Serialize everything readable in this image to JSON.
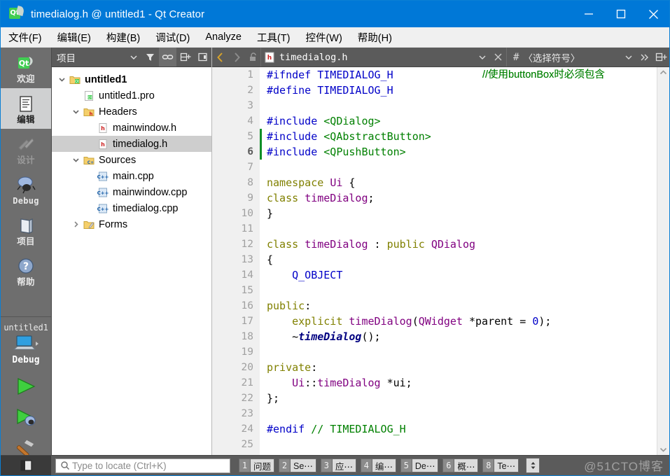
{
  "window": {
    "title": "timedialog.h @ untitled1 - Qt Creator",
    "app_icon": "qt-logo-icon",
    "minimize_label": "minimize-icon",
    "maximize_label": "maximize-icon",
    "close_label": "close-icon",
    "titlebar_color": "#0078d7"
  },
  "menubar": {
    "items": [
      {
        "text": "文件(F)",
        "mnemonic": "F"
      },
      {
        "text": "编辑(E)",
        "mnemonic": "E"
      },
      {
        "text": "构建(B)",
        "mnemonic": "B"
      },
      {
        "text": "调试(D)",
        "mnemonic": "D"
      },
      {
        "text": "Analyze",
        "mnemonic": "A"
      },
      {
        "text": "工具(T)",
        "mnemonic": "T"
      },
      {
        "text": "控件(W)",
        "mnemonic": "W"
      },
      {
        "text": "帮助(H)",
        "mnemonic": "H"
      }
    ]
  },
  "modebar": {
    "modes": [
      {
        "label": "欢迎",
        "icon": "qt-welcome-icon",
        "state": "normal"
      },
      {
        "label": "编辑",
        "icon": "document-edit-icon",
        "state": "selected"
      },
      {
        "label": "设计",
        "icon": "design-brush-icon",
        "state": "disabled"
      },
      {
        "label": "Debug",
        "icon": "bug-icon",
        "state": "normal"
      },
      {
        "label": "项目",
        "icon": "projects-book-icon",
        "state": "normal"
      },
      {
        "label": "帮助",
        "icon": "help-question-icon",
        "state": "normal"
      }
    ],
    "kit": {
      "project": "untitled1",
      "icon": "desktop-target-icon",
      "build_config": "Debug"
    },
    "actions": [
      {
        "name": "run-button",
        "icon": "green-play-icon"
      },
      {
        "name": "debug-button",
        "icon": "play-bug-icon"
      },
      {
        "name": "build-button",
        "icon": "hammer-icon"
      }
    ]
  },
  "project_panel": {
    "combo_label": "项目",
    "toolbar_icons": [
      {
        "name": "filter-icon"
      },
      {
        "name": "link-sync-icon",
        "active": true
      },
      {
        "name": "split-add-icon"
      },
      {
        "name": "close-panel-icon"
      }
    ],
    "tree": [
      {
        "label": "untitled1",
        "indent": 0,
        "arrow": "down",
        "icon": "qt-project-icon",
        "bold": true,
        "selected": false
      },
      {
        "label": "untitled1.pro",
        "indent": 1,
        "arrow": "none",
        "icon": "pro-file-icon",
        "bold": false,
        "selected": false
      },
      {
        "label": "Headers",
        "indent": 1,
        "arrow": "down",
        "icon": "folder-h-icon",
        "bold": false,
        "selected": false
      },
      {
        "label": "mainwindow.h",
        "indent": 2,
        "arrow": "none",
        "icon": "header-file-icon",
        "bold": false,
        "selected": false
      },
      {
        "label": "timedialog.h",
        "indent": 2,
        "arrow": "none",
        "icon": "header-file-icon",
        "bold": false,
        "selected": true
      },
      {
        "label": "Sources",
        "indent": 1,
        "arrow": "down",
        "icon": "folder-cpp-icon",
        "bold": false,
        "selected": false
      },
      {
        "label": "main.cpp",
        "indent": 2,
        "arrow": "none",
        "icon": "cpp-file-icon",
        "bold": false,
        "selected": false
      },
      {
        "label": "mainwindow.cpp",
        "indent": 2,
        "arrow": "none",
        "icon": "cpp-file-icon",
        "bold": false,
        "selected": false
      },
      {
        "label": "timedialog.cpp",
        "indent": 2,
        "arrow": "none",
        "icon": "cpp-file-icon",
        "bold": false,
        "selected": false
      },
      {
        "label": "Forms",
        "indent": 1,
        "arrow": "right",
        "icon": "folder-forms-icon",
        "bold": false,
        "selected": false
      }
    ]
  },
  "editor_toolbar": {
    "back_icon": "back-arrow-icon",
    "forward_icon": "forward-arrow-icon",
    "lock_icon": "unlocked-padlock-icon",
    "file_icon": "header-file-icon",
    "file_name": "timedialog.h",
    "file_dropdown_icon": "chevron-down-icon",
    "close_icon": "close-icon",
    "symbol_hash": "#",
    "symbol_label": "〈选择符号〉",
    "symbol_dropdown_icon": "chevron-down-icon",
    "overflow_icon": "chevron-double-right-icon",
    "split_icon": "split-editor-icon"
  },
  "editor": {
    "current_line": 6,
    "lines": [
      {
        "n": 1,
        "fold": "",
        "changed": false,
        "tokens": [
          {
            "t": "#ifndef ",
            "c": "pre"
          },
          {
            "t": "TIMEDIALOG_H",
            "c": "mac"
          }
        ]
      },
      {
        "n": 2,
        "fold": "",
        "changed": false,
        "tokens": [
          {
            "t": "#define ",
            "c": "pre"
          },
          {
            "t": "TIMEDIALOG_H",
            "c": "mac"
          }
        ]
      },
      {
        "n": 3,
        "fold": "",
        "changed": false,
        "tokens": []
      },
      {
        "n": 4,
        "fold": "",
        "changed": false,
        "tokens": [
          {
            "t": "#include ",
            "c": "pre"
          },
          {
            "t": "<QDialog>",
            "c": "str"
          }
        ]
      },
      {
        "n": 5,
        "fold": "",
        "changed": true,
        "tokens": [
          {
            "t": "#include ",
            "c": "pre"
          },
          {
            "t": "<QAbstractButton>",
            "c": "str"
          }
        ],
        "comment": "//使用buttonBox时必须包含"
      },
      {
        "n": 6,
        "fold": "",
        "changed": true,
        "tokens": [
          {
            "t": "#include ",
            "c": "pre"
          },
          {
            "t": "<QPushButton>",
            "c": "str"
          }
        ],
        "comment": "//使用buttonBox时必须包含"
      },
      {
        "n": 7,
        "fold": "",
        "changed": false,
        "tokens": []
      },
      {
        "n": 8,
        "fold": "down",
        "changed": false,
        "tokens": [
          {
            "t": "namespace ",
            "c": "key"
          },
          {
            "t": "Ui",
            "c": "typ"
          },
          {
            "t": " {",
            "c": "txt"
          }
        ]
      },
      {
        "n": 9,
        "fold": "",
        "changed": false,
        "tokens": [
          {
            "t": "class ",
            "c": "key"
          },
          {
            "t": "timeDialog",
            "c": "typ"
          },
          {
            "t": ";",
            "c": "txt"
          }
        ]
      },
      {
        "n": 10,
        "fold": "",
        "changed": false,
        "tokens": [
          {
            "t": "}",
            "c": "txt"
          }
        ]
      },
      {
        "n": 11,
        "fold": "",
        "changed": false,
        "tokens": []
      },
      {
        "n": 12,
        "fold": "down",
        "changed": false,
        "tokens": [
          {
            "t": "class ",
            "c": "key"
          },
          {
            "t": "timeDialog",
            "c": "typ"
          },
          {
            "t": " : ",
            "c": "txt"
          },
          {
            "t": "public ",
            "c": "key"
          },
          {
            "t": "QDialog",
            "c": "typ"
          }
        ]
      },
      {
        "n": 13,
        "fold": "",
        "changed": false,
        "tokens": [
          {
            "t": "{",
            "c": "txt"
          }
        ]
      },
      {
        "n": 14,
        "fold": "",
        "changed": false,
        "tokens": [
          {
            "t": "    Q_OBJECT",
            "c": "mac"
          }
        ]
      },
      {
        "n": 15,
        "fold": "",
        "changed": false,
        "tokens": []
      },
      {
        "n": 16,
        "fold": "",
        "changed": false,
        "tokens": [
          {
            "t": "public",
            "c": "key"
          },
          {
            "t": ":",
            "c": "txt"
          }
        ]
      },
      {
        "n": 17,
        "fold": "",
        "changed": false,
        "tokens": [
          {
            "t": "    ",
            "c": "txt"
          },
          {
            "t": "explicit ",
            "c": "key"
          },
          {
            "t": "timeDialog",
            "c": "typ"
          },
          {
            "t": "(",
            "c": "txt"
          },
          {
            "t": "QWidget",
            "c": "typ"
          },
          {
            "t": " *parent = ",
            "c": "txt"
          },
          {
            "t": "0",
            "c": "pre"
          },
          {
            "t": ");",
            "c": "txt"
          }
        ]
      },
      {
        "n": 18,
        "fold": "",
        "changed": false,
        "tokens": [
          {
            "t": "    ~",
            "c": "txt"
          },
          {
            "t": "timeDialog",
            "c": "fn"
          },
          {
            "t": "();",
            "c": "txt"
          }
        ]
      },
      {
        "n": 19,
        "fold": "",
        "changed": false,
        "tokens": []
      },
      {
        "n": 20,
        "fold": "",
        "changed": false,
        "tokens": [
          {
            "t": "private",
            "c": "key"
          },
          {
            "t": ":",
            "c": "txt"
          }
        ]
      },
      {
        "n": 21,
        "fold": "",
        "changed": false,
        "tokens": [
          {
            "t": "    ",
            "c": "txt"
          },
          {
            "t": "Ui",
            "c": "typ"
          },
          {
            "t": "::",
            "c": "txt"
          },
          {
            "t": "timeDialog",
            "c": "typ"
          },
          {
            "t": " *ui;",
            "c": "txt"
          }
        ]
      },
      {
        "n": 22,
        "fold": "",
        "changed": false,
        "tokens": [
          {
            "t": "};",
            "c": "txt"
          }
        ]
      },
      {
        "n": 23,
        "fold": "",
        "changed": false,
        "tokens": []
      },
      {
        "n": 24,
        "fold": "",
        "changed": false,
        "tokens": [
          {
            "t": "#endif ",
            "c": "pre"
          },
          {
            "t": "// TIMEDIALOG_H",
            "c": "cmt"
          }
        ]
      },
      {
        "n": 25,
        "fold": "",
        "changed": false,
        "tokens": []
      }
    ],
    "scroll_up_icon": "chevron-up-icon",
    "scroll_down_icon": "chevron-down-icon"
  },
  "statusbar": {
    "sidebar_toggle_icon": "sidebar-toggle-icon",
    "locator_icon": "search-icon",
    "locator_placeholder": "Type to locate (Ctrl+K)",
    "locator_value": "",
    "panes": [
      {
        "num": "1",
        "label": "问题"
      },
      {
        "num": "2",
        "label": "Se⋯"
      },
      {
        "num": "3",
        "label": "应⋯"
      },
      {
        "num": "4",
        "label": "编⋯"
      },
      {
        "num": "5",
        "label": "De⋯"
      },
      {
        "num": "6",
        "label": "概⋯"
      },
      {
        "num": "8",
        "label": "Te⋯"
      }
    ],
    "updown_icon": "up-down-arrows-icon",
    "watermark": "@51CTO博客"
  }
}
